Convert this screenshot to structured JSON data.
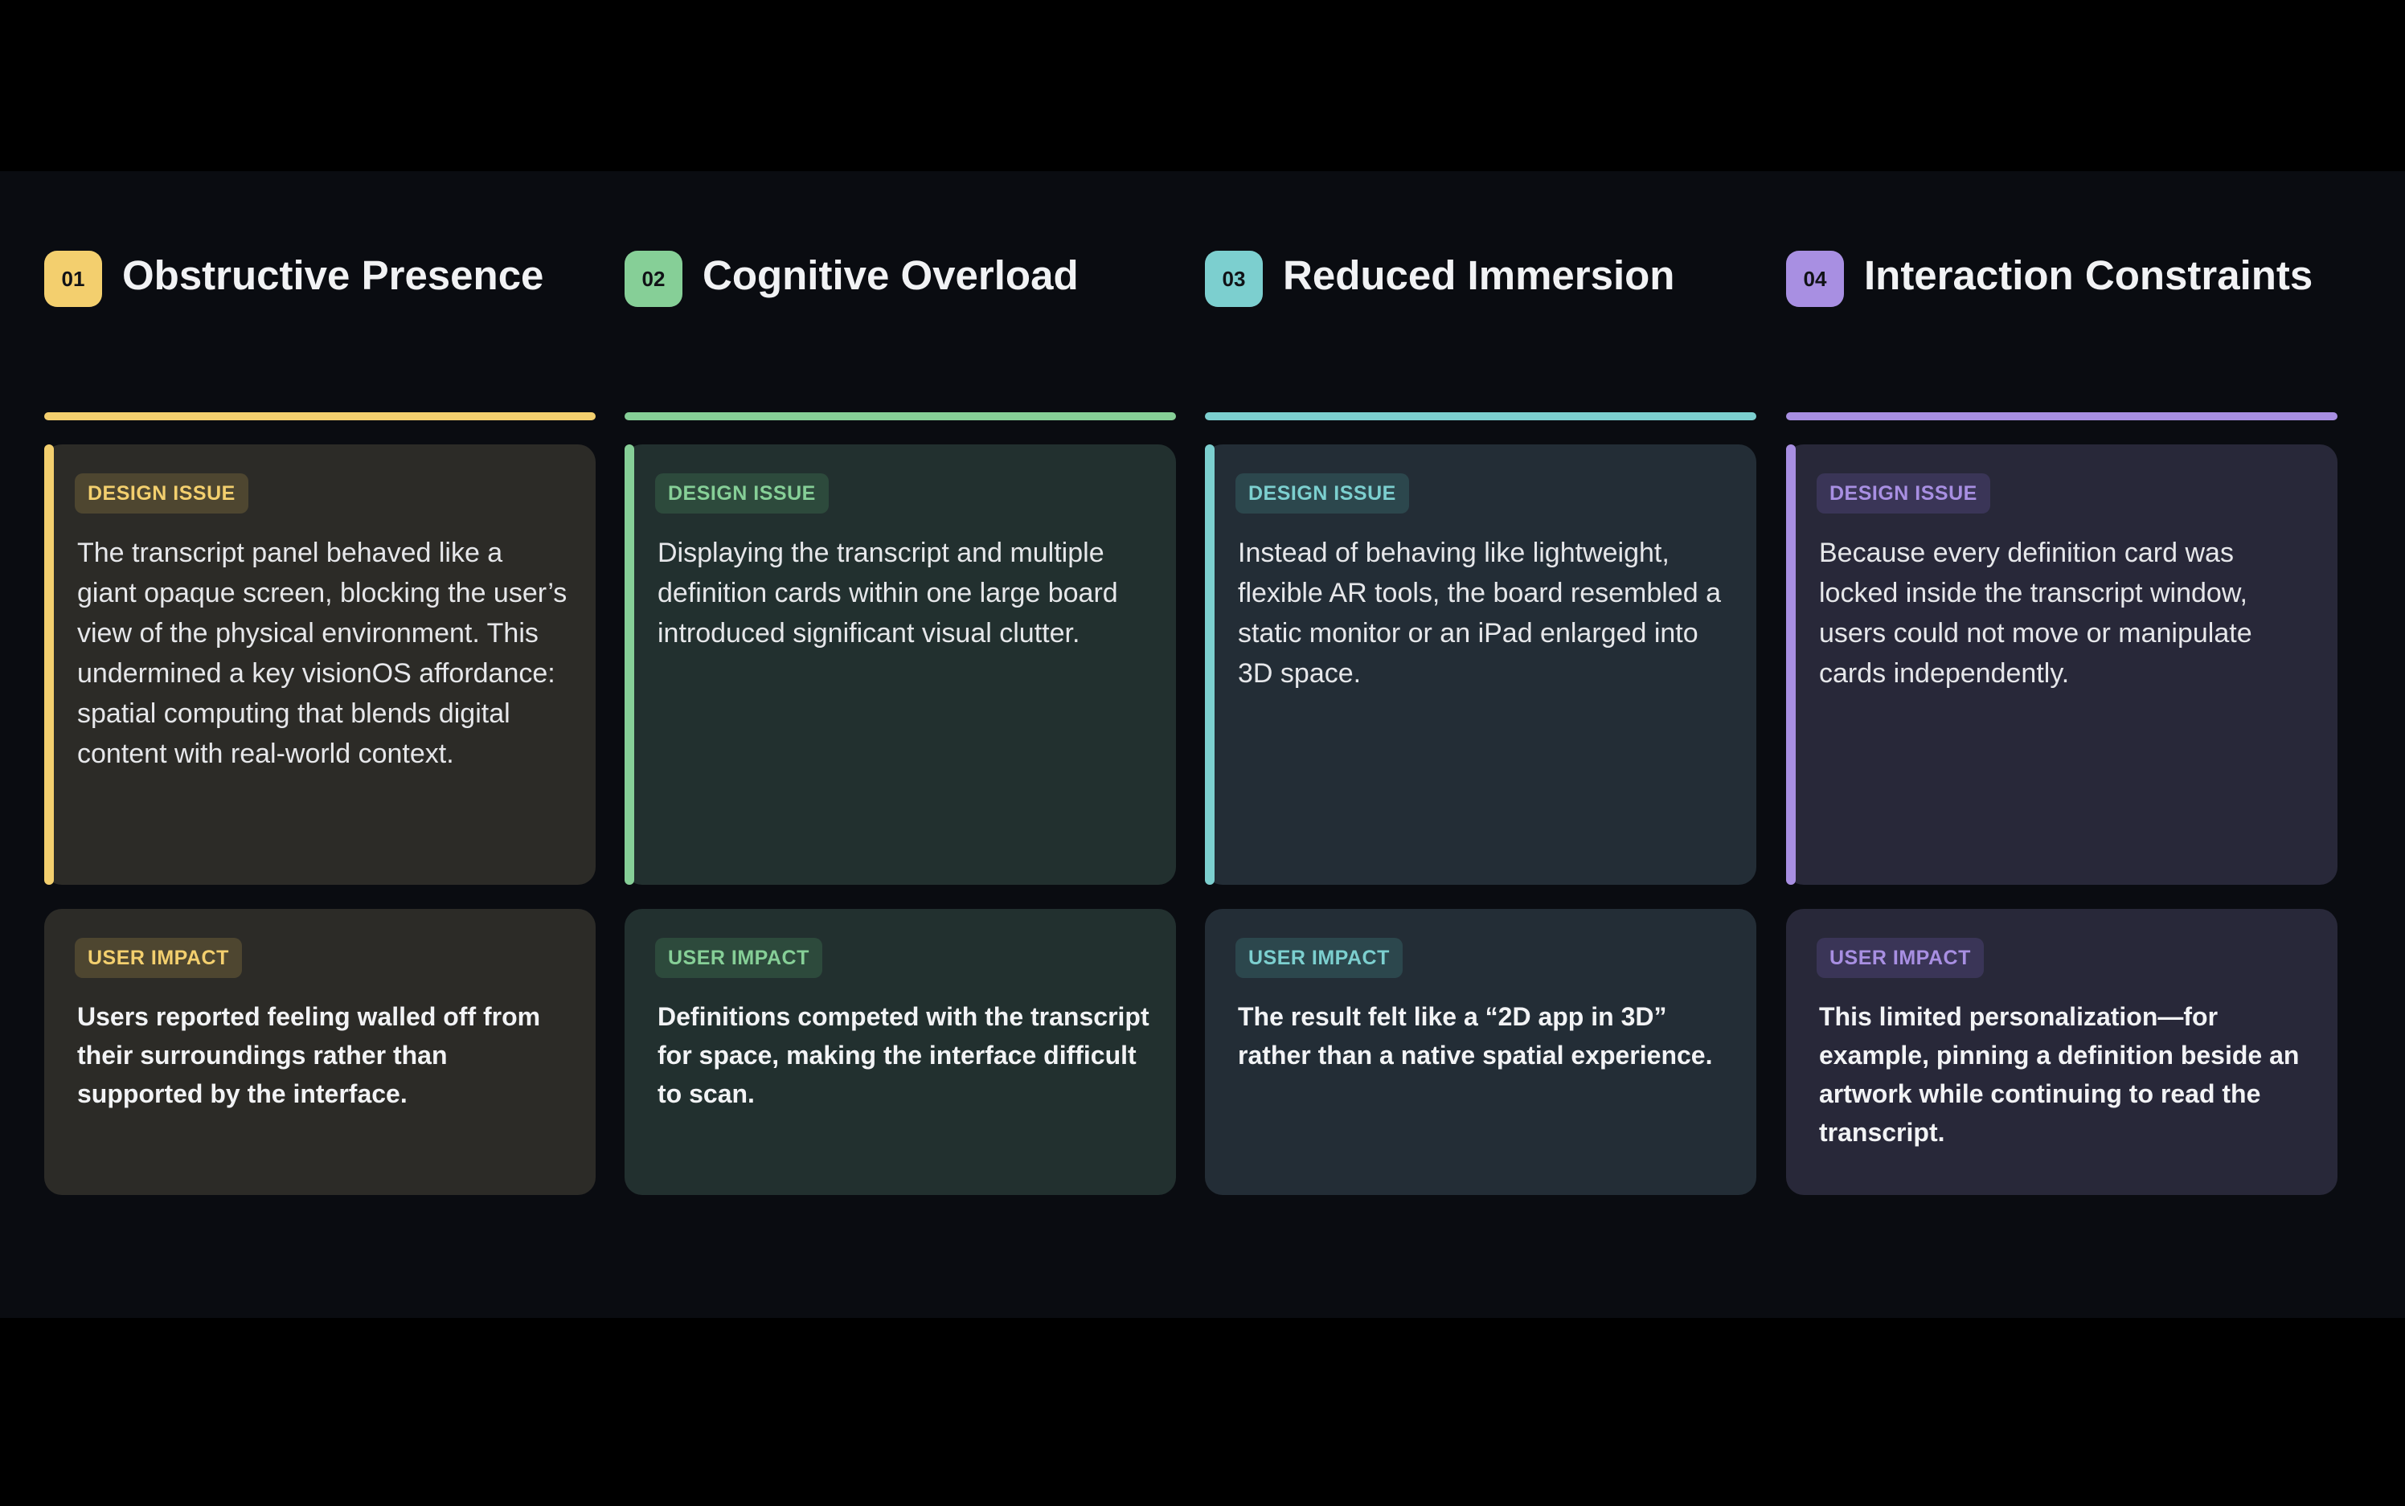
{
  "columns": [
    {
      "number": "01",
      "title": "Obstructive Presence",
      "accent_color": "#f3cf6e",
      "design_issue": {
        "tag": "DESIGN ISSUE",
        "text": "The transcript panel behaved like a giant opaque screen, blocking the user’s view of the physical environment. This undermined a key visionOS affordance: spatial computing that blends digital content with real-world context."
      },
      "user_impact": {
        "tag": "USER IMPACT",
        "text": "Users reported feeling walled off from their surroundings rather than supported by the interface."
      }
    },
    {
      "number": "02",
      "title": "Cognitive Overload",
      "accent_color": "#86cf97",
      "design_issue": {
        "tag": "DESIGN ISSUE",
        "text": "Displaying the transcript and multiple definition cards within one large board introduced significant visual clutter."
      },
      "user_impact": {
        "tag": "USER IMPACT",
        "text": "Definitions competed with the transcript for space, making the interface difficult to scan."
      }
    },
    {
      "number": "03",
      "title": "Reduced Immersion",
      "accent_color": "#7ccfcf",
      "design_issue": {
        "tag": "DESIGN ISSUE",
        "text": "Instead of behaving like lightweight, flexible AR tools, the board resembled a static monitor or an iPad enlarged into 3D space."
      },
      "user_impact": {
        "tag": "USER IMPACT",
        "text": "The result felt like a “2D app in 3D” rather than a native spatial experience."
      }
    },
    {
      "number": "04",
      "title": "Interaction Constraints",
      "accent_color": "#a88fe2",
      "design_issue": {
        "tag": "DESIGN ISSUE",
        "text": "Because every definition card was locked inside the transcript window, users could not move or manipulate cards independently."
      },
      "user_impact": {
        "tag": "USER IMPACT",
        "text": "This limited personalization—for example, pinning a definition beside an artwork while continuing to read the transcript."
      }
    }
  ]
}
